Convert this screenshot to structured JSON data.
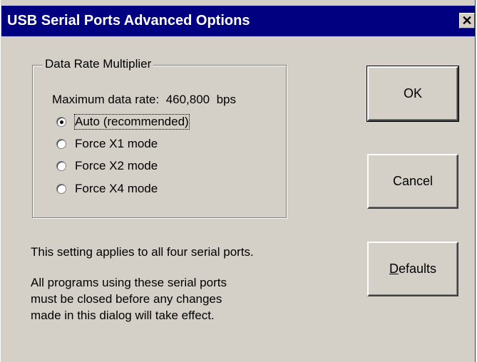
{
  "window": {
    "title": "USB Serial Ports Advanced Options",
    "close_glyph": "✕"
  },
  "group": {
    "legend": "Data Rate Multiplier",
    "max_rate_label": "Maximum data rate:",
    "max_rate_value": "460,800",
    "max_rate_unit": "bps",
    "options": [
      {
        "label": "Auto (recommended)",
        "selected": true
      },
      {
        "label": "Force X1 mode",
        "selected": false
      },
      {
        "label": "Force X2 mode",
        "selected": false
      },
      {
        "label": "Force X4 mode",
        "selected": false
      }
    ]
  },
  "info": {
    "line1": "This setting applies to all four serial ports.",
    "note_lines": [
      "All programs using these serial ports",
      "must be closed before any changes",
      "made in this dialog will take effect."
    ]
  },
  "buttons": {
    "ok": "OK",
    "cancel": "Cancel",
    "defaults_first": "D",
    "defaults_rest": "efaults"
  },
  "colors": {
    "titlebar": "#000080",
    "face": "#d4d0c8"
  }
}
